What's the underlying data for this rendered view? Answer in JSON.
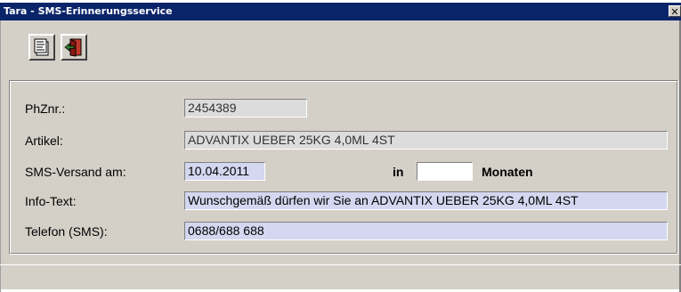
{
  "window": {
    "title": "Tara - SMS-Erinnerungsservice",
    "close_glyph": "✕"
  },
  "toolbar": {
    "buttons": [
      {
        "icon": "document-list-icon"
      },
      {
        "icon": "exit-door-icon"
      }
    ]
  },
  "form": {
    "phznr": {
      "label": "PhZnr.:",
      "value": "2454389"
    },
    "artikel": {
      "label": "Artikel:",
      "value": "ADVANTIX UEBER 25KG 4,0ML 4ST"
    },
    "sms_versand": {
      "label": "SMS-Versand am:",
      "value": "10.04.2011",
      "in_label": "in",
      "months_value": "",
      "months_label": "Monaten"
    },
    "info_text": {
      "label": "Info-Text:",
      "value": "Wunschgemäß dürfen wir Sie an ADVANTIX UEBER 25KG 4,0ML 4ST"
    },
    "telefon": {
      "label": "Telefon (SMS):",
      "value": "0688/688 688"
    }
  },
  "colors": {
    "titlebar": "#0a246a",
    "window_bg": "#d4d0c8",
    "editable_field": "#d3d7ef",
    "readonly_field": "#dcdcdc"
  }
}
